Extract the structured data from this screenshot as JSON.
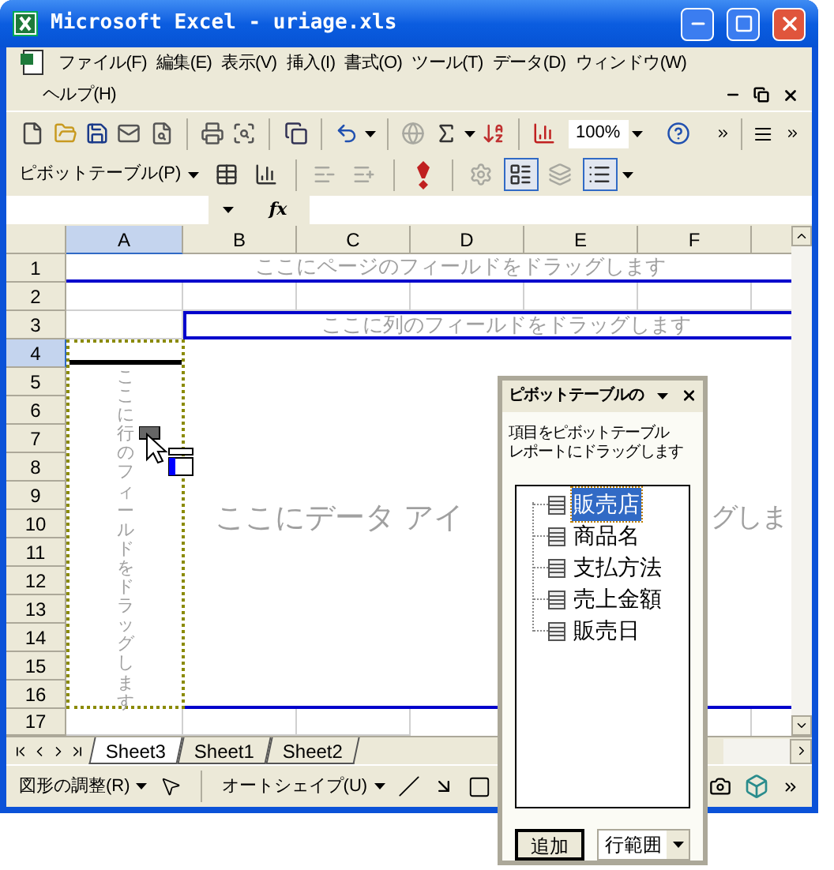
{
  "window": {
    "title": "Microsoft Excel - uriage.xls"
  },
  "menu": [
    {
      "label": "ファイル(F)"
    },
    {
      "label": "編集(E)"
    },
    {
      "label": "表示(V)"
    },
    {
      "label": "挿入(I)"
    },
    {
      "label": "書式(O)"
    },
    {
      "label": "ツール(T)"
    },
    {
      "label": "データ(D)"
    },
    {
      "label": "ウィンドウ(W)"
    },
    {
      "label": "ヘルプ(H)"
    }
  ],
  "standard_toolbar": {
    "zoom": "100%",
    "buttons": [
      {
        "disabled": false
      },
      {
        "disabled": false
      },
      {
        "disabled": false
      },
      {
        "disabled": false
      },
      {
        "disabled": false
      },
      {
        "disabled": false
      },
      {
        "disabled": false
      },
      {
        "disabled": false
      },
      {
        "disabled": false
      },
      {
        "disabled": true
      },
      {
        "disabled": false
      },
      {
        "disabled": false
      },
      {
        "disabled": false
      },
      {
        "disabled": false
      }
    ]
  },
  "pivot_toolbar": {
    "label": "ピボットテーブル(P)",
    "buttons": [
      {
        "disabled": false,
        "pressed": false
      },
      {
        "disabled": false,
        "pressed": false
      },
      {
        "disabled": true,
        "pressed": false
      },
      {
        "disabled": true,
        "pressed": false
      },
      {
        "disabled": false,
        "pressed": false
      },
      {
        "disabled": true,
        "pressed": false
      },
      {
        "disabled": false,
        "pressed": true
      },
      {
        "disabled": true,
        "pressed": false
      },
      {
        "disabled": false,
        "pressed": true
      }
    ]
  },
  "formula_bar": {
    "fx": "fx"
  },
  "columns": [
    {
      "label": "A",
      "selected": true
    },
    {
      "label": "B",
      "selected": false
    },
    {
      "label": "C",
      "selected": false
    },
    {
      "label": "D",
      "selected": false
    },
    {
      "label": "E",
      "selected": false
    },
    {
      "label": "F",
      "selected": false
    }
  ],
  "rows": [
    {
      "label": "1",
      "selected": false
    },
    {
      "label": "2",
      "selected": false
    },
    {
      "label": "3",
      "selected": false
    },
    {
      "label": "4",
      "selected": true
    },
    {
      "label": "5",
      "selected": false
    },
    {
      "label": "6",
      "selected": false
    },
    {
      "label": "7",
      "selected": false
    },
    {
      "label": "8",
      "selected": false
    },
    {
      "label": "9",
      "selected": false
    },
    {
      "label": "10",
      "selected": false
    },
    {
      "label": "11",
      "selected": false
    },
    {
      "label": "12",
      "selected": false
    },
    {
      "label": "13",
      "selected": false
    },
    {
      "label": "14",
      "selected": false
    },
    {
      "label": "15",
      "selected": false
    },
    {
      "label": "16",
      "selected": false
    },
    {
      "label": "17",
      "selected": false
    }
  ],
  "pivot_areas": {
    "page": "ここにページのフィールドをドラッグします",
    "column": "ここに列のフィールドをドラッグします",
    "row": "ここに行のフィールドをドラッグします",
    "data_visible": [
      "ここにデータ アイ",
      "グしま"
    ]
  },
  "sheet_tabs": [
    {
      "label": "Sheet3",
      "selected": true
    },
    {
      "label": "Sheet1",
      "selected": false
    },
    {
      "label": "Sheet2",
      "selected": false
    }
  ],
  "drawing_toolbar": {
    "draw_menu": "図形の調整(R)",
    "autoshapes": "オートシェイプ(U)"
  },
  "field_list": {
    "title": "ピボットテーブルの",
    "instructions": [
      "項目をピボットテーブル",
      "レポートにドラッグします"
    ],
    "fields": [
      {
        "label": "販売店",
        "selected": true
      },
      {
        "label": "商品名",
        "selected": false
      },
      {
        "label": "支払方法",
        "selected": false
      },
      {
        "label": "売上金額",
        "selected": false
      },
      {
        "label": "販売日",
        "selected": false
      }
    ],
    "add_button": "追加",
    "area": "行範囲"
  }
}
